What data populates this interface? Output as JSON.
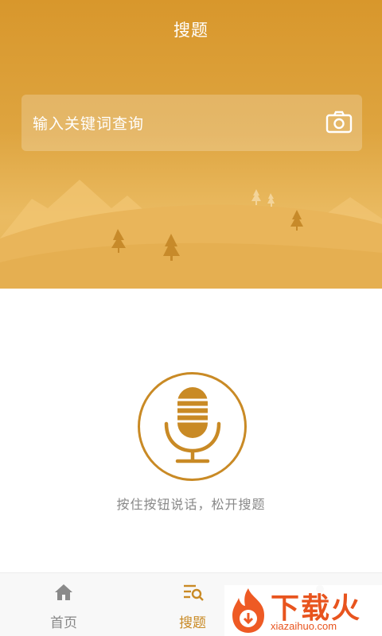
{
  "header": {
    "title": "搜题"
  },
  "search": {
    "placeholder": "输入关键词查询",
    "camera_icon": "camera-icon"
  },
  "voice": {
    "hint": "按住按钮说话，松开搜题",
    "mic_icon": "microphone-icon"
  },
  "tabbar": {
    "items": [
      {
        "label": "首页",
        "icon": "home-icon",
        "active": false
      },
      {
        "label": "搜题",
        "icon": "search-list-icon",
        "active": true
      }
    ]
  },
  "watermark": {
    "text": "下载火",
    "url": "xiazaihuo.com"
  },
  "colors": {
    "accent": "#c98a25",
    "header_gradient_top": "#d8972c",
    "inactive_text": "#888888",
    "watermark": "#e8541e"
  }
}
